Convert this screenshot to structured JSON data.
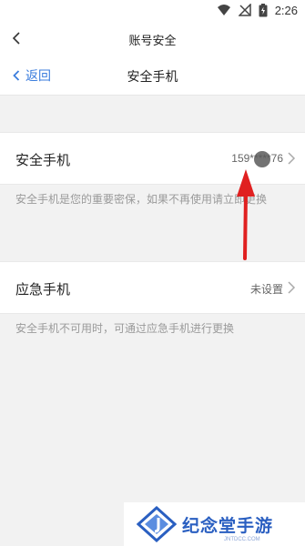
{
  "status_bar": {
    "time": "2:26",
    "icons": [
      "wifi-icon",
      "signal-off-icon",
      "battery-icon"
    ]
  },
  "title_bar": {
    "title": "账号安全",
    "back_icon": "chevron-left-icon"
  },
  "nav_bar": {
    "back_label": "返回",
    "title": "安全手机",
    "accent_color": "#3b7ddd"
  },
  "security_phone": {
    "label": "安全手机",
    "value": "159*****76",
    "hint": "安全手机是您的重要密保，如果不再使用请立即更换"
  },
  "emergency_phone": {
    "label": "应急手机",
    "value": "未设置",
    "hint": "安全手机不可用时，可通过应急手机进行更换"
  },
  "annotation": {
    "color": "#e02020"
  },
  "watermark": {
    "text": "纪念堂手游",
    "sub": "JNTDCC.COM"
  }
}
